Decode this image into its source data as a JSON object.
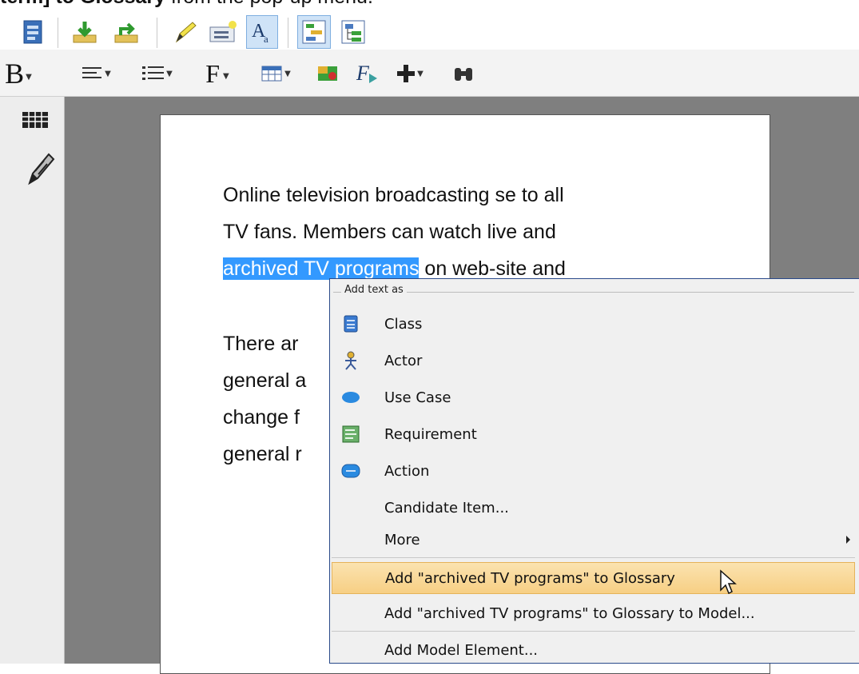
{
  "instruction": {
    "prefix": "term]",
    "middle": " to ",
    "target": "Glossary",
    "suffix": " from the pop-up menu."
  },
  "toolbar_row1": {
    "icons": [
      "document-icon",
      "import-down-icon",
      "export-up-icon",
      "highlighter-icon",
      "add-note-icon",
      "text-format-icon",
      "diagram-view-icon",
      "tree-view-icon"
    ]
  },
  "toolbar_row2": {
    "bold_label": "B",
    "font_label": "F"
  },
  "document": {
    "para1": {
      "line1": "Online television broadcasting se to all",
      "line2": "TV fans. Members can watch live and",
      "line3_selected": "archived TV programs",
      "line3_rest": " on web-site and"
    },
    "para2": {
      "line1": "There ar",
      "line2": "general a",
      "line3": "change f",
      "line4": "general r"
    }
  },
  "context_menu": {
    "header": "Add text as",
    "items": [
      {
        "label": "Class",
        "icon": "class-icon"
      },
      {
        "label": "Actor",
        "icon": "actor-icon"
      },
      {
        "label": "Use Case",
        "icon": "use-case-icon"
      },
      {
        "label": "Requirement",
        "icon": "requirement-icon"
      },
      {
        "label": "Action",
        "icon": "action-icon"
      },
      {
        "label": "Candidate Item..."
      },
      {
        "label": "More"
      }
    ],
    "glossary_item": "Add \"archived TV programs\" to Glossary",
    "glossary_model_item": "Add \"archived TV programs\" to Glossary to Model...",
    "model_element_item": "Add Model Element..."
  },
  "colors": {
    "selection": "#3399ff",
    "menu_hover": "#f7cf84",
    "canvas": "#7f7f7f"
  }
}
